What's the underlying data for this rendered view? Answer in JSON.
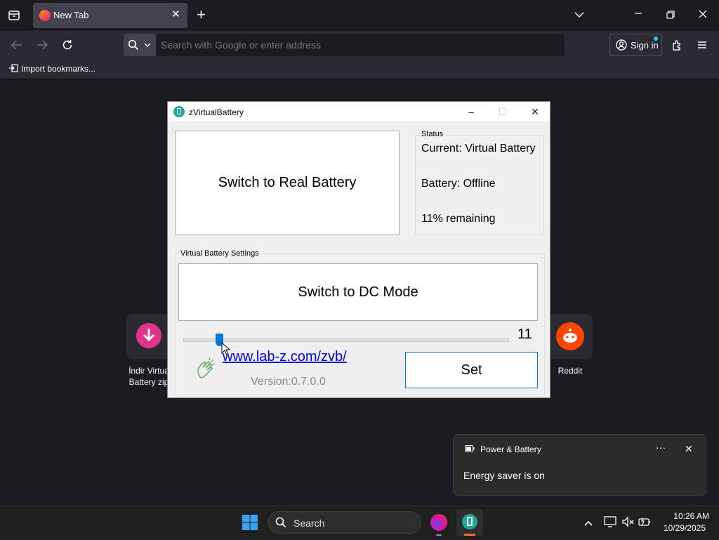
{
  "browser": {
    "tab_title": "New Tab",
    "url_placeholder": "Search with Google or enter address",
    "signin_label": "Sign in",
    "bookmark_label": "Import bookmarks..."
  },
  "shortcuts": [
    {
      "label_line1": "İndir Virtua",
      "label_line2": "Battery zip"
    },
    {
      "label_line1": "Reddit",
      "label_line2": ""
    }
  ],
  "app": {
    "title": "zVirtualBattery",
    "switch_battery_label": "Switch to Real Battery",
    "status_group_label": "Status",
    "status_current": "Current: Virtual Battery",
    "status_battery": "Battery: Offline",
    "status_remaining": "11% remaining",
    "settings_group_label": "Virtual Battery Settings",
    "switch_mode_label": "Switch to DC Mode",
    "slider_value": "11",
    "slider_fraction": 0.11,
    "link_text": "www.lab-z.com/zvb/",
    "version_text": "Version:0.7.0.0",
    "set_label": "Set"
  },
  "notification": {
    "title": "Power & Battery",
    "body": "Energy saver is on"
  },
  "taskbar": {
    "search_label": "Search",
    "time": "10:26 AM",
    "date": "10/29/2025"
  },
  "colors": {
    "accent": "#0078d7",
    "link": "#0000ee",
    "reddit": "#ff4500",
    "download": "#e0348a"
  }
}
